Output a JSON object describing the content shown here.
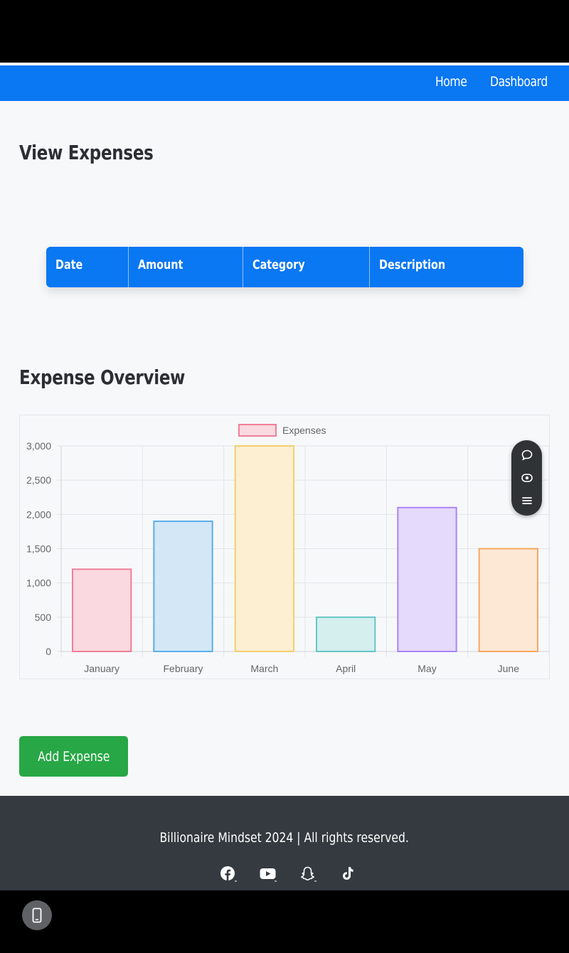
{
  "nav": {
    "home": "Home",
    "dashboard": "Dashboard"
  },
  "headings": {
    "view": "View Expenses",
    "overview": "Expense Overview"
  },
  "table": {
    "columns": [
      "Date",
      "Amount",
      "Category",
      "Description"
    ]
  },
  "chart_data": {
    "type": "bar",
    "categories": [
      "January",
      "February",
      "March",
      "April",
      "May",
      "June"
    ],
    "series": [
      {
        "name": "Expenses",
        "values": [
          1200,
          1900,
          3000,
          500,
          2100,
          1500
        ]
      }
    ],
    "ylim": [
      0,
      3000
    ],
    "yticks": [
      0,
      500,
      1000,
      1500,
      2000,
      2500,
      3000
    ],
    "ytick_labels": [
      "0",
      "500",
      "1,000",
      "1,500",
      "2,000",
      "2,500",
      "3,000"
    ],
    "legend": "top",
    "grid": true,
    "fill_colors": [
      "#fad9e0",
      "#d3e7f7",
      "#fcefd2",
      "#d4efee",
      "#e5dafb",
      "#fde8d6"
    ],
    "border_colors": [
      "#f07f99",
      "#5aaeea",
      "#f5ce6e",
      "#65c6c6",
      "#a985f7",
      "#f5a95f"
    ]
  },
  "buttons": {
    "add_expense": "Add Expense"
  },
  "footer": {
    "text": "Billionaire Mindset 2024 | All rights reserved."
  },
  "icons": {
    "fab": [
      "comment-icon",
      "eye-icon",
      "menu-icon"
    ],
    "social": [
      "facebook-icon",
      "youtube-icon",
      "snapchat-icon",
      "tiktok-icon"
    ],
    "system": "phone-screen-icon"
  }
}
